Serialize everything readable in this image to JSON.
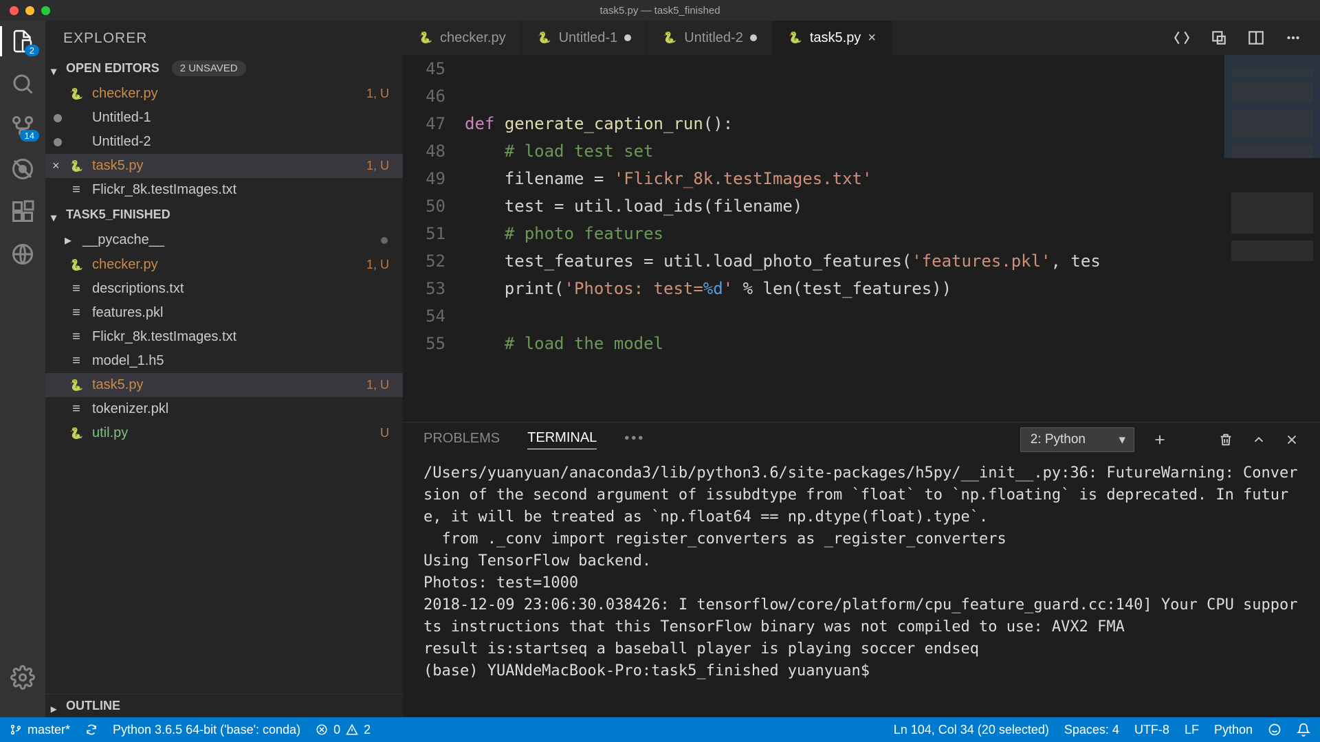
{
  "window": {
    "title": "task5.py — task5_finished"
  },
  "sidebar": {
    "title": "EXPLORER",
    "openEditors": {
      "header": "OPEN EDITORS",
      "unsaved": "2 UNSAVED",
      "items": [
        {
          "name": "checker.py",
          "meta": "1, U",
          "type": "py",
          "dirty": false,
          "amber": true
        },
        {
          "name": "Untitled-1",
          "meta": "",
          "type": "plain",
          "dirty": true
        },
        {
          "name": "Untitled-2",
          "meta": "",
          "type": "plain",
          "dirty": true
        },
        {
          "name": "task5.py",
          "meta": "1, U",
          "type": "py",
          "dirty": false,
          "active": true,
          "amber": true
        },
        {
          "name": "Flickr_8k.testImages.txt",
          "meta": "",
          "type": "txt",
          "dirty": false
        }
      ]
    },
    "folder": {
      "header": "TASK5_FINISHED",
      "items": [
        {
          "name": "__pycache__",
          "meta": "",
          "type": "folder",
          "dimdot": true
        },
        {
          "name": "checker.py",
          "meta": "1, U",
          "type": "py",
          "amber": true
        },
        {
          "name": "descriptions.txt",
          "meta": "",
          "type": "txt"
        },
        {
          "name": "features.pkl",
          "meta": "",
          "type": "txt"
        },
        {
          "name": "Flickr_8k.testImages.txt",
          "meta": "",
          "type": "txt"
        },
        {
          "name": "model_1.h5",
          "meta": "",
          "type": "txt"
        },
        {
          "name": "task5.py",
          "meta": "1, U",
          "type": "py",
          "active": true,
          "amber": true
        },
        {
          "name": "tokenizer.pkl",
          "meta": "",
          "type": "txt"
        },
        {
          "name": "util.py",
          "meta": "U",
          "type": "py",
          "green": true
        }
      ]
    },
    "outline": "OUTLINE"
  },
  "activity": {
    "explorerBadge": "2",
    "scmBadge": "14"
  },
  "tabs": [
    {
      "label": "checker.py",
      "icon": "py",
      "dirty": false
    },
    {
      "label": "Untitled-1",
      "icon": "py",
      "dirty": true
    },
    {
      "label": "Untitled-2",
      "icon": "py",
      "dirty": true
    },
    {
      "label": "task5.py",
      "icon": "py",
      "dirty": false,
      "active": true,
      "close": true
    }
  ],
  "editor": {
    "startLine": 45,
    "lines": [
      "",
      "",
      "<span class='kw'>def</span> <span class='fn'>generate_caption_run</span>():",
      "    <span class='cm'># load test set</span>",
      "    filename = <span class='str'>'Flickr_8k.testImages.txt'</span>",
      "    test = util.load_ids(filename)",
      "    <span class='cm'># photo features</span>",
      "    test_features = util.load_photo_features(<span class='str'>'features.pkl'</span>, tes",
      "    print(<span class='str'>'Photos: test=</span><span class='fmt'>%d</span><span class='str'>'</span> % len(test_features))",
      "",
      "    <span class='cm'># load the model</span>"
    ]
  },
  "panel": {
    "tabs": {
      "problems": "PROBLEMS",
      "terminal": "TERMINAL"
    },
    "terminalSelect": "2: Python",
    "output": "/Users/yuanyuan/anaconda3/lib/python3.6/site-packages/h5py/__init__.py:36: FutureWarning: Conversion of the second argument of issubdtype from `float` to `np.floating` is deprecated. In future, it will be treated as `np.float64 == np.dtype(float).type`.\n  from ._conv import register_converters as _register_converters\nUsing TensorFlow backend.\nPhotos: test=1000\n2018-12-09 23:06:30.038426: I tensorflow/core/platform/cpu_feature_guard.cc:140] Your CPU supports instructions that this TensorFlow binary was not compiled to use: AVX2 FMA\nresult is:startseq a baseball player is playing soccer endseq\n(base) YUANdeMacBook-Pro:task5_finished yuanyuan$ "
  },
  "status": {
    "branch": "master*",
    "python": "Python 3.6.5 64-bit ('base': conda)",
    "errors": "0",
    "warnings": "2",
    "cursor": "Ln 104, Col 34 (20 selected)",
    "spaces": "Spaces: 4",
    "encoding": "UTF-8",
    "eol": "LF",
    "lang": "Python"
  }
}
